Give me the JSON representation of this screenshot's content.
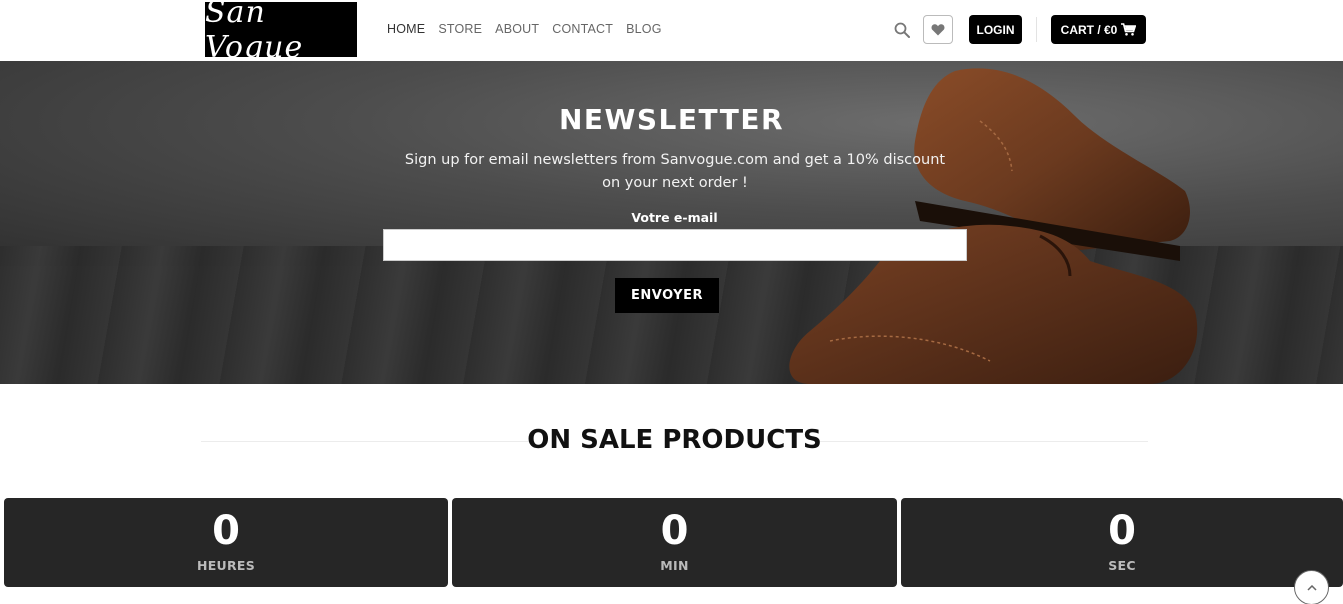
{
  "header": {
    "logo_text": "San Vogue",
    "nav": [
      "HOME",
      "STORE",
      "ABOUT",
      "CONTACT",
      "BLOG"
    ],
    "login_label": "LOGIN",
    "cart_label": "CART / €0",
    "icons": [
      "search-icon",
      "heart-icon",
      "cart-icon"
    ]
  },
  "newsletter": {
    "title": "NEWSLETTER",
    "text": "Sign up for email newsletters from Sanvogue.com and get a 10% discount on your next order !",
    "email_label": "Votre e-mail",
    "email_value": "",
    "submit_label": "ENVOYER"
  },
  "sale": {
    "title": "ON SALE PRODUCTS",
    "countdown": [
      {
        "value": "0",
        "label": "HEURES"
      },
      {
        "value": "0",
        "label": "MIN"
      },
      {
        "value": "0",
        "label": "SEC"
      }
    ]
  },
  "colors": {
    "button_bg": "#000000",
    "countdown_bg": "#262626",
    "hero_bg": "#3e3e3e",
    "shoe_brown": "#6b3a1f"
  }
}
